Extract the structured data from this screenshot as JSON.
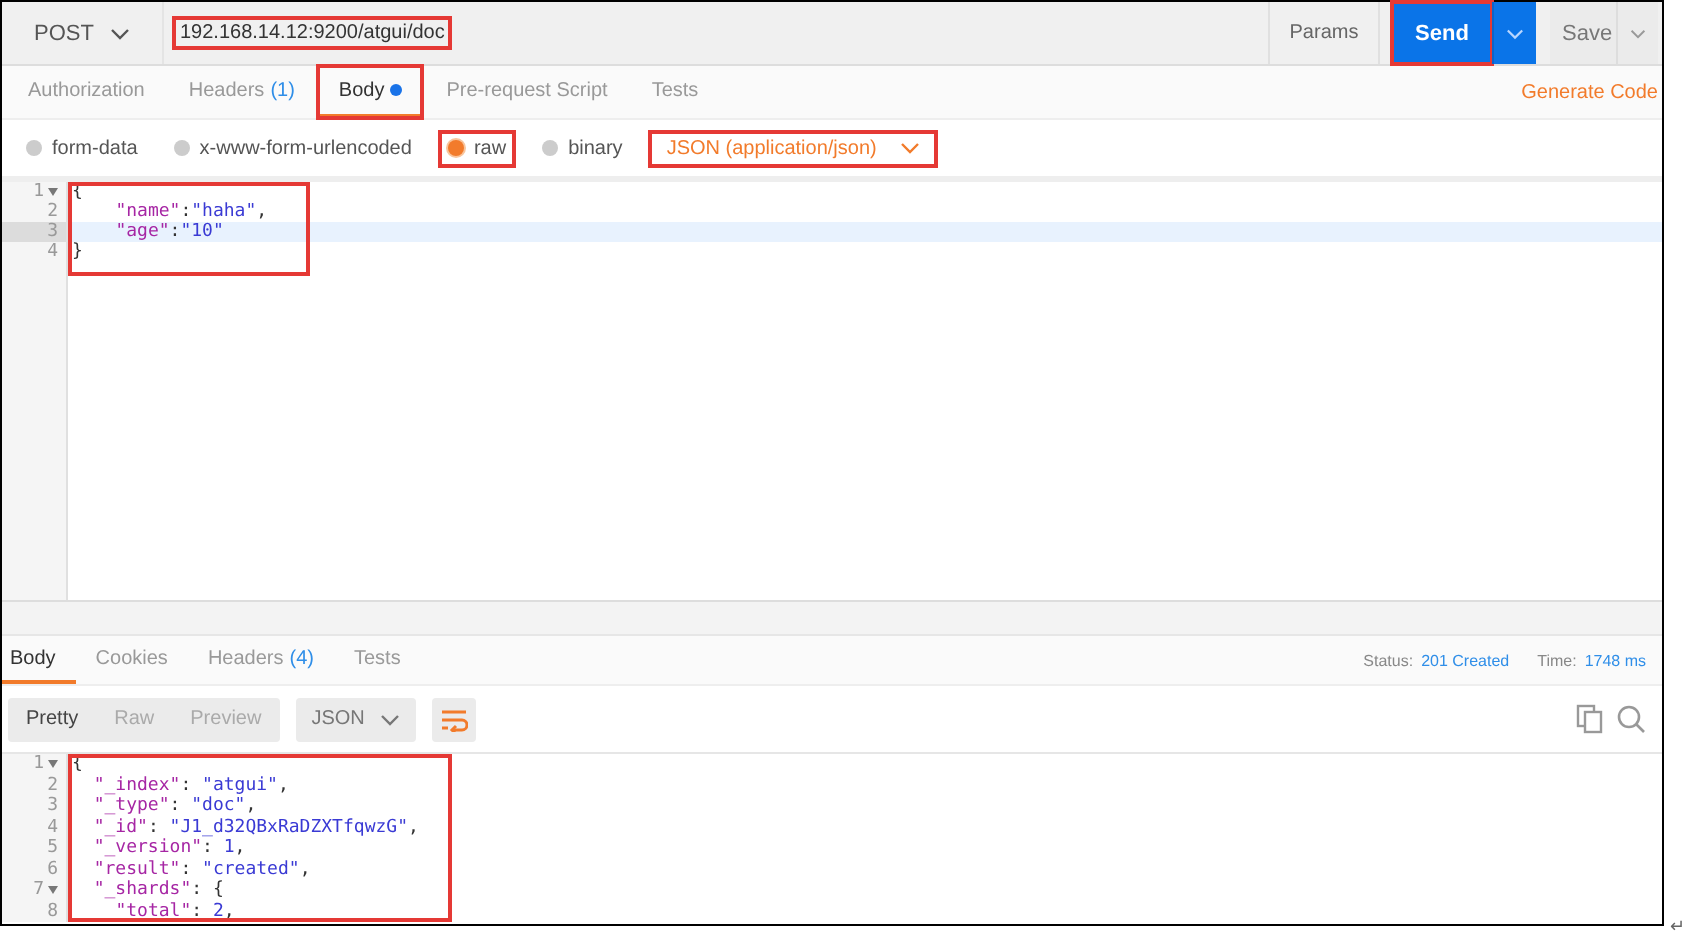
{
  "method": {
    "label": "POST"
  },
  "url": {
    "value": "192.168.14.12:9200/atgui/doc",
    "highlighted": true
  },
  "actions": {
    "params": "Params",
    "send": {
      "label": "Send",
      "highlighted": true
    },
    "save": "Save"
  },
  "request_tabs": [
    {
      "label": "Authorization",
      "dot": false,
      "selected": false,
      "highlighted": false
    },
    {
      "label": "Headers",
      "count": "(1)",
      "dot": false,
      "selected": false,
      "highlighted": false
    },
    {
      "label": "Body",
      "dot": true,
      "selected": true,
      "highlighted": true
    },
    {
      "label": "Pre-request Script",
      "dot": false,
      "selected": false,
      "highlighted": false
    },
    {
      "label": "Tests",
      "dot": false,
      "selected": false,
      "highlighted": false
    }
  ],
  "generate_code": "Generate Code",
  "body_types": [
    {
      "label": "form-data",
      "selected": false,
      "highlighted": false
    },
    {
      "label": "x-www-form-urlencoded",
      "selected": false,
      "highlighted": false
    },
    {
      "label": "raw",
      "selected": true,
      "highlighted": true
    },
    {
      "label": "binary",
      "selected": false,
      "highlighted": false
    }
  ],
  "content_type": {
    "label": "JSON (application/json)",
    "highlighted": true
  },
  "request_editor": {
    "highlighted": true,
    "lines": [
      {
        "number": "1",
        "text": "{",
        "fold": true,
        "active": false
      },
      {
        "number": "2",
        "text": "    \"name\":\"haha\",",
        "fold": false,
        "active": false
      },
      {
        "number": "3",
        "text": "    \"age\":\"10\"",
        "fold": false,
        "active": true
      },
      {
        "number": "4",
        "text": "}",
        "fold": false,
        "active": false
      }
    ]
  },
  "response_tabs": [
    {
      "label": "Body",
      "selected": true
    },
    {
      "label": "Cookies",
      "selected": false
    },
    {
      "label": "Headers",
      "count": "(4)",
      "selected": false
    },
    {
      "label": "Tests",
      "selected": false
    }
  ],
  "status": {
    "label": "Status:",
    "value": "201 Created"
  },
  "time": {
    "label": "Time:",
    "value": "1748 ms"
  },
  "view_modes": [
    {
      "label": "Pretty",
      "selected": true
    },
    {
      "label": "Raw",
      "selected": false
    },
    {
      "label": "Preview",
      "selected": false
    }
  ],
  "format": {
    "label": "JSON"
  },
  "response_editor": {
    "highlighted": true,
    "lines": [
      {
        "number": "1",
        "text": "{",
        "fold": true,
        "active": false
      },
      {
        "number": "2",
        "text": "  \"_index\": \"atgui\",",
        "fold": false,
        "active": false
      },
      {
        "number": "3",
        "text": "  \"_type\": \"doc\",",
        "fold": false,
        "active": false
      },
      {
        "number": "4",
        "text": "  \"_id\": \"J1_d32QBxRaDZXTfqwzG\",",
        "fold": false,
        "active": false
      },
      {
        "number": "5",
        "text": "  \"_version\": 1,",
        "fold": false,
        "active": false
      },
      {
        "number": "6",
        "text": "  \"result\": \"created\",",
        "fold": false,
        "active": false
      },
      {
        "number": "7",
        "text": "  \"_shards\": {",
        "fold": true,
        "active": false
      },
      {
        "number": "8",
        "text": "    \"total\": 2,",
        "fold": false,
        "active": false
      }
    ]
  },
  "paragraph_mark": "↵"
}
